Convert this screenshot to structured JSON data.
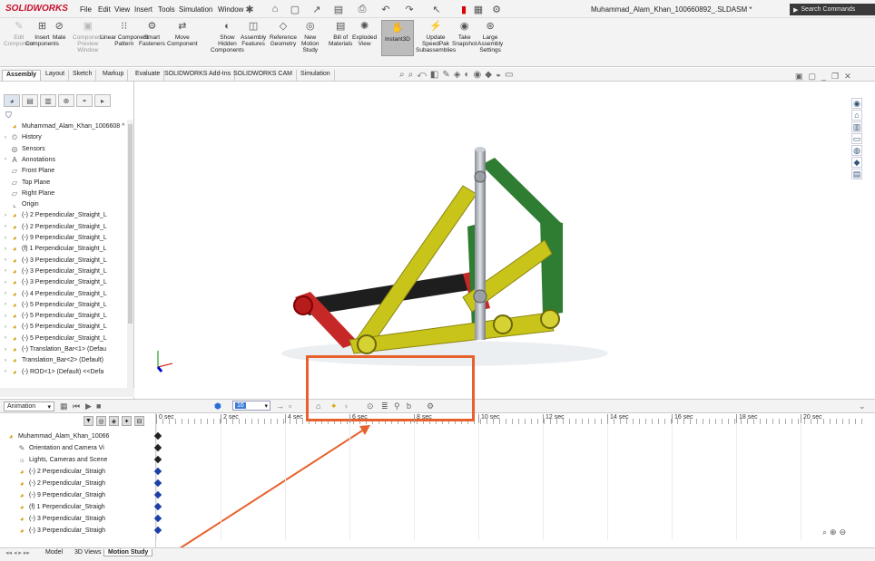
{
  "app": {
    "logo": "SOLIDWORKS",
    "title": "Muhammad_Alam_Khan_100660892_.SLDASM *",
    "search_placeholder": "Search Commands"
  },
  "menus": [
    "File",
    "Edit",
    "View",
    "Insert",
    "Tools",
    "Simulation",
    "Window"
  ],
  "ribbon": [
    {
      "label": "Edit\nComponent",
      "icon": "edit-component-icon",
      "disabled": true
    },
    {
      "label": "Insert\nComponents",
      "icon": "insert-components-icon"
    },
    {
      "label": "Mate",
      "icon": "mate-icon"
    },
    {
      "label": "Component\nPreview\nWindow",
      "icon": "preview-window-icon",
      "disabled": true
    },
    {
      "label": "Linear Component\nPattern",
      "icon": "linear-pattern-icon"
    },
    {
      "label": "Smart\nFasteners",
      "icon": "smart-fasteners-icon"
    },
    {
      "label": "Move\nComponent",
      "icon": "move-component-icon"
    },
    {
      "label": "Show\nHidden\nComponents",
      "icon": "show-hidden-icon"
    },
    {
      "label": "Assembly\nFeatures",
      "icon": "assembly-features-icon"
    },
    {
      "label": "Reference\nGeometry",
      "icon": "reference-geometry-icon"
    },
    {
      "label": "New\nMotion\nStudy",
      "icon": "motion-study-icon"
    },
    {
      "label": "Bill of\nMaterials",
      "icon": "bom-icon"
    },
    {
      "label": "Exploded\nView",
      "icon": "exploded-view-icon"
    },
    {
      "label": "Instant3D",
      "icon": "instant3d-icon",
      "active": true
    },
    {
      "label": "Update\nSpeedPak\nSubassemblies",
      "icon": "speedpak-icon"
    },
    {
      "label": "Take\nSnapshot",
      "icon": "snapshot-icon"
    },
    {
      "label": "Large\nAssembly\nSettings",
      "icon": "large-assembly-icon"
    }
  ],
  "command_tabs": [
    "Assembly",
    "Layout",
    "Sketch",
    "Markup",
    "Evaluate",
    "SOLIDWORKS Add-Ins",
    "SOLIDWORKS CAM",
    "Simulation"
  ],
  "tree": [
    {
      "label": "Muhammad_Alam_Khan_1006608 ^",
      "icon": "assembly-icon",
      "color": "#d4a017"
    },
    {
      "label": "History",
      "icon": "history-icon",
      "tri": true
    },
    {
      "label": "Sensors",
      "icon": "sensors-icon"
    },
    {
      "label": "Annotations",
      "icon": "annotations-icon",
      "tri": true
    },
    {
      "label": "Front Plane",
      "icon": "plane-icon"
    },
    {
      "label": "Top Plane",
      "icon": "plane-icon"
    },
    {
      "label": "Right Plane",
      "icon": "plane-icon"
    },
    {
      "label": "Origin",
      "icon": "origin-icon"
    },
    {
      "label": "(-) 2 Perpendicular_Straight_L",
      "icon": "part-icon",
      "tri": true
    },
    {
      "label": "(-) 2 Perpendicular_Straight_L",
      "icon": "part-icon",
      "tri": true
    },
    {
      "label": "(-) 9 Perpendicular_Straight_L",
      "icon": "part-icon",
      "tri": true
    },
    {
      "label": "(f) 1 Perpendicular_Straight_L",
      "icon": "part-icon",
      "tri": true
    },
    {
      "label": "(-) 3 Perpendicular_Straight_L",
      "icon": "part-icon",
      "tri": true
    },
    {
      "label": "(-) 3 Perpendicular_Straight_L",
      "icon": "part-icon",
      "tri": true
    },
    {
      "label": "(-) 3 Perpendicular_Straight_L",
      "icon": "part-icon",
      "tri": true
    },
    {
      "label": "(-) 4 Perpendicular_Straight_L",
      "icon": "part-icon",
      "tri": true
    },
    {
      "label": "(-) 5 Perpendicular_Straight_L",
      "icon": "part-icon",
      "tri": true
    },
    {
      "label": "(-) 5 Perpendicular_Straight_L",
      "icon": "part-icon",
      "tri": true
    },
    {
      "label": "(-) 5 Perpendicular_Straight_L",
      "icon": "part-icon",
      "tri": true
    },
    {
      "label": "(-) 5 Perpendicular_Straight_L",
      "icon": "part-icon",
      "tri": true
    },
    {
      "label": "(-) Translation_Bar<1> (Defau",
      "icon": "part-icon",
      "tri": true
    },
    {
      "label": "Translation_Bar<2> (Default)",
      "icon": "part-icon",
      "tri": true
    },
    {
      "label": "(-) ROD<1> (Default) <<Defa",
      "icon": "part-icon",
      "tri": true
    }
  ],
  "animation": {
    "mode": "Animation",
    "fps": "16"
  },
  "timeline": {
    "ticks": [
      "0 sec",
      "2 sec",
      "4 sec",
      "6 sec",
      "8 sec",
      "10 sec",
      "12 sec",
      "14 sec",
      "16 sec",
      "18 sec",
      "20 sec"
    ],
    "rows": [
      {
        "label": "Muhammad_Alam_Khan_10066",
        "icon": "assembly-icon"
      },
      {
        "label": "Orientation and Camera Vi",
        "icon": "camera-icon"
      },
      {
        "label": "Lights, Cameras and Scene",
        "icon": "lights-icon"
      },
      {
        "label": "(-) 2 Perpendicular_Straigh",
        "icon": "part-icon"
      },
      {
        "label": "(-) 2 Perpendicular_Straigh",
        "icon": "part-icon"
      },
      {
        "label": "(-) 9 Perpendicular_Straigh",
        "icon": "part-icon"
      },
      {
        "label": "(f) 1 Perpendicular_Straigh",
        "icon": "part-icon"
      },
      {
        "label": "(-) 3 Perpendicular_Straigh",
        "icon": "part-icon"
      },
      {
        "label": "(-) 3 Perpendicular_Straigh",
        "icon": "part-icon"
      }
    ]
  },
  "bottom_tabs": [
    "Model",
    "3D Views",
    "Motion Study"
  ],
  "colors": {
    "accent_red": "#e8612c",
    "yellow_link": "#c8c41a",
    "green_link": "#2e7d32",
    "red_link": "#c62828"
  }
}
